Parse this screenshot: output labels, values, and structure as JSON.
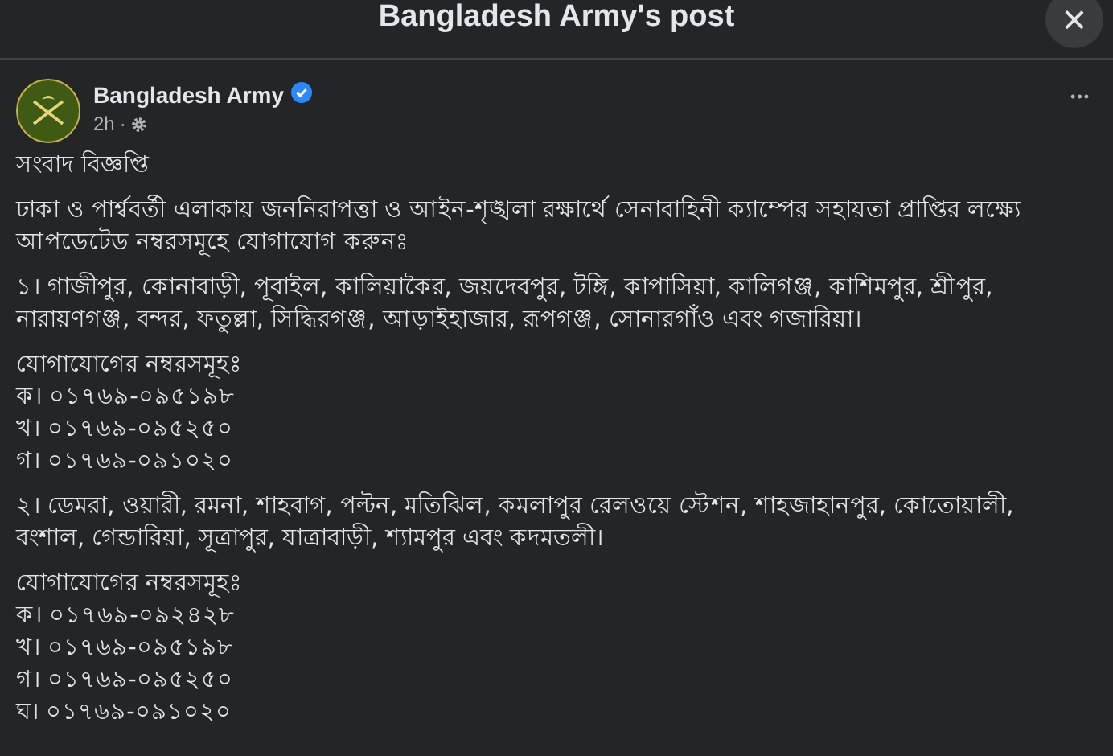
{
  "dialog": {
    "title": "Bangladesh Army's post",
    "close": "×"
  },
  "post": {
    "author": "Bangladesh Army",
    "verified": true,
    "time": "2h",
    "separator": "·",
    "more": "•••",
    "blocks": [
      {
        "lines": [
          "সংবাদ বিজ্ঞপ্তি"
        ]
      },
      {
        "lines": [
          "ঢাকা ও পার্শ্ববর্তী এলাকায় জননিরাপত্তা ও আইন-শৃঙ্খলা রক্ষার্থে সেনাবাহিনী ক্যাম্পের সহায়তা প্রাপ্তির লক্ষ্যে আপডেটেড নম্বরসমূহে যোগাযোগ করুনঃ"
        ]
      },
      {
        "lines": [
          "১। গাজীপুর, কোনাবাড়ী, পূবাইল, কালিয়াকৈর, জয়দেবপুর, টঙ্গি, কাপাসিয়া, কালিগঞ্জ, কাশিমপুর, শ্রীপুর, নারায়ণগঞ্জ, বন্দর, ফতুল্লা, সিদ্ধিরগঞ্জ, আড়াইহাজার, রূপগঞ্জ, সোনারগাঁও এবং গজারিয়া।"
        ]
      },
      {
        "lines": [
          "যোগাযোগের নম্বরসমূহঃ",
          "ক। ০১৭৬৯-০৯৫১৯৮",
          "খ। ০১৭৬৯-০৯৫২৫০",
          "গ। ০১৭৬৯-০৯১০২০"
        ]
      },
      {
        "lines": [
          "২। ডেমরা, ওয়ারী, রমনা, শাহবাগ, পল্টন, মতিঝিল, কমলাপুর রেলওয়ে স্টেশন, শাহজাহানপুর, কোতোয়ালী, বংশাল, গেন্ডারিয়া, সূত্রাপুর, যাত্রাবাড়ী, শ্যামপুর এবং কদমতলী।"
        ]
      },
      {
        "lines": [
          "যোগাযোগের নম্বরসমূহঃ",
          "ক। ০১৭৬৯-০৯২৪২৮",
          "খ। ০১৭৬৯-০৯৫১৯৮",
          "গ। ০১৭৬৯-০৯৫২৫০",
          "ঘ। ০১৭৬৯-০৯১০২০"
        ]
      }
    ]
  }
}
